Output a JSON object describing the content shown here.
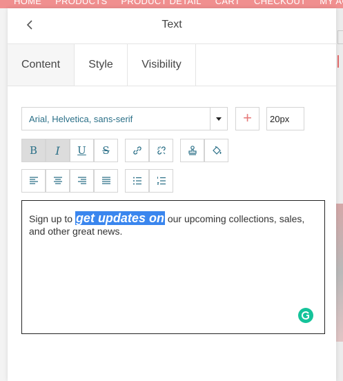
{
  "background": {
    "nav_items": [
      "HOME",
      "PRODUCTS",
      "PRODUCT DETAIL",
      "CART",
      "CHECKOUT",
      "MY ACCOUNT"
    ]
  },
  "panel": {
    "title": "Text",
    "back_icon": "chevron-left-icon",
    "tabs": [
      {
        "label": "Content",
        "active": true
      },
      {
        "label": "Style",
        "active": false
      },
      {
        "label": "Visibility",
        "active": false
      }
    ]
  },
  "font": {
    "family": "Arial, Helvetica, sans-serif",
    "add_label": "+",
    "size": "20px"
  },
  "toolbar": {
    "format": [
      {
        "name": "bold",
        "label": "B",
        "active": true
      },
      {
        "name": "italic",
        "label": "I",
        "active": true
      },
      {
        "name": "underline",
        "label": "U",
        "active": false
      },
      {
        "name": "strikethrough",
        "label": "S",
        "active": false
      }
    ],
    "link": [
      "link-icon",
      "unlink-icon"
    ],
    "paint": [
      "stamp-icon",
      "paint-bucket-icon"
    ],
    "align": [
      "align-left-icon",
      "align-center-icon",
      "align-right-icon",
      "align-justify-icon"
    ],
    "lists": [
      "bullet-list-icon",
      "numbered-list-icon"
    ]
  },
  "editor": {
    "text_before": "Sign up to ",
    "text_highlight": "get updates on",
    "text_after": " our upcoming collections, sales, and other great news.",
    "highlight_color": "#3a86ee"
  },
  "colors": {
    "accent": "#2a6f87",
    "nav_bg": "#f08f8f",
    "grammarly": "#15c39a"
  }
}
